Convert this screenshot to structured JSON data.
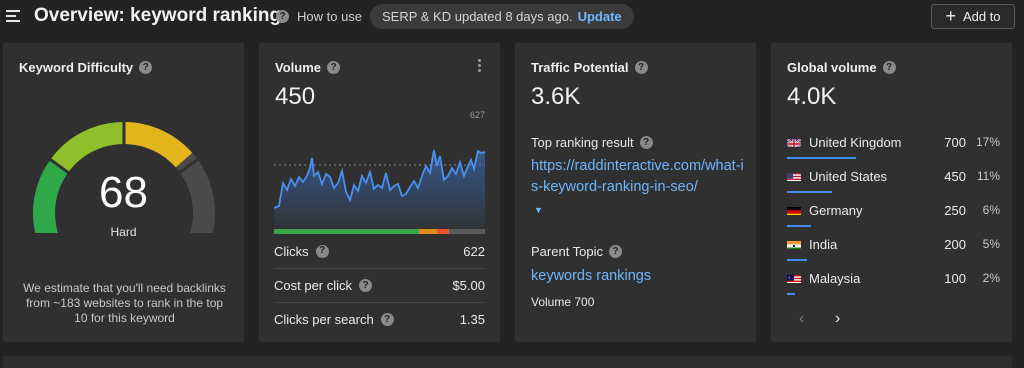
{
  "header": {
    "title": "Overview: keyword ranking",
    "howto": "How to use",
    "status": "SERP & KD updated 8 days ago.",
    "update": "Update",
    "add_label": "Add to"
  },
  "kd": {
    "title": "Keyword Difficulty",
    "value": "68",
    "level": "Hard",
    "gauge_fraction": 0.68,
    "description": "We estimate that you'll need backlinks from ~183 websites to rank in the top 10 for this keyword"
  },
  "volume": {
    "title": "Volume",
    "value": "450",
    "chart_max_label": "627",
    "rows": [
      {
        "label": "Clicks",
        "value": "622"
      },
      {
        "label": "Cost per click",
        "value": "$5.00"
      },
      {
        "label": "Clicks per search",
        "value": "1.35"
      }
    ],
    "colors": {
      "organic": "#3aa64a",
      "paid": "#e08a1e",
      "paid2": "#e8542c",
      "none": "#5a5a5a"
    }
  },
  "traffic": {
    "title": "Traffic Potential",
    "value": "3.6K",
    "top_result_label": "Top ranking result",
    "top_result_url": "https://raddinteractive.com/what-is-keyword-ranking-in-seo/",
    "parent_label": "Parent Topic",
    "parent_topic": "keywords rankings",
    "parent_volume": "Volume 700"
  },
  "global": {
    "title": "Global volume",
    "value": "4.0K",
    "countries": [
      {
        "name": "United Kingdom",
        "volume": "700",
        "pct": "17%",
        "share": 0.17,
        "flag": "uk"
      },
      {
        "name": "United States",
        "volume": "450",
        "pct": "11%",
        "share": 0.11,
        "flag": "us"
      },
      {
        "name": "Germany",
        "volume": "250",
        "pct": "6%",
        "share": 0.06,
        "flag": "de"
      },
      {
        "name": "India",
        "volume": "200",
        "pct": "5%",
        "share": 0.05,
        "flag": "in"
      },
      {
        "name": "Malaysia",
        "volume": "100",
        "pct": "2%",
        "share": 0.02,
        "flag": "my"
      }
    ],
    "accent": "#3f8ef0"
  }
}
